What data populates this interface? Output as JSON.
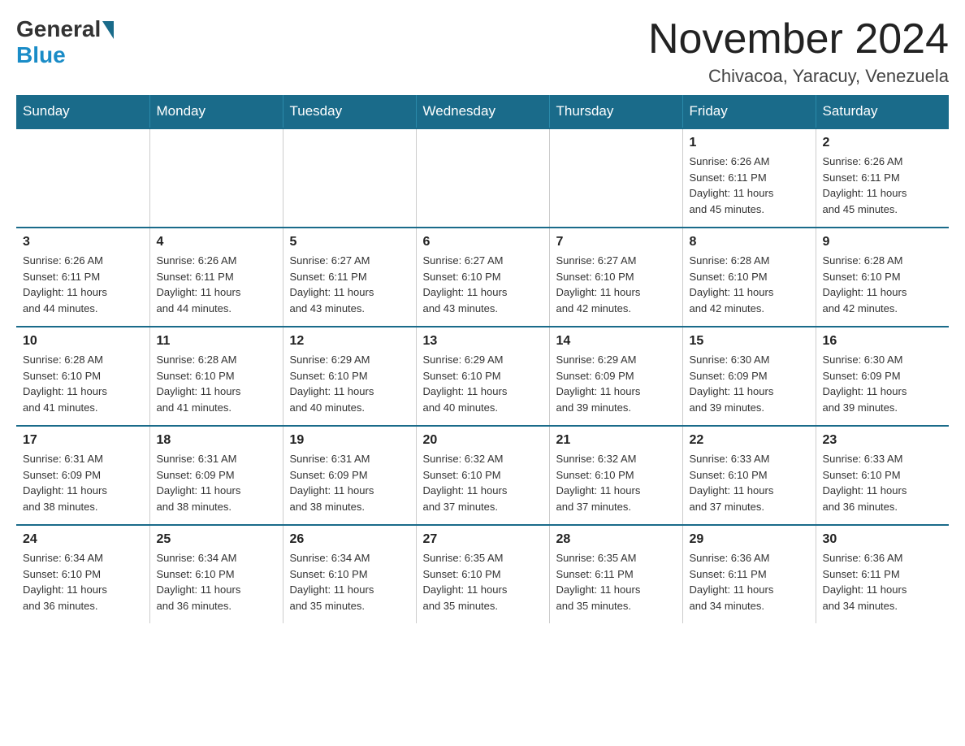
{
  "logo": {
    "text_general": "General",
    "text_blue": "Blue"
  },
  "title": "November 2024",
  "location": "Chivacoa, Yaracuy, Venezuela",
  "days_of_week": [
    "Sunday",
    "Monday",
    "Tuesday",
    "Wednesday",
    "Thursday",
    "Friday",
    "Saturday"
  ],
  "weeks": [
    [
      {
        "day": "",
        "info": ""
      },
      {
        "day": "",
        "info": ""
      },
      {
        "day": "",
        "info": ""
      },
      {
        "day": "",
        "info": ""
      },
      {
        "day": "",
        "info": ""
      },
      {
        "day": "1",
        "info": "Sunrise: 6:26 AM\nSunset: 6:11 PM\nDaylight: 11 hours\nand 45 minutes."
      },
      {
        "day": "2",
        "info": "Sunrise: 6:26 AM\nSunset: 6:11 PM\nDaylight: 11 hours\nand 45 minutes."
      }
    ],
    [
      {
        "day": "3",
        "info": "Sunrise: 6:26 AM\nSunset: 6:11 PM\nDaylight: 11 hours\nand 44 minutes."
      },
      {
        "day": "4",
        "info": "Sunrise: 6:26 AM\nSunset: 6:11 PM\nDaylight: 11 hours\nand 44 minutes."
      },
      {
        "day": "5",
        "info": "Sunrise: 6:27 AM\nSunset: 6:11 PM\nDaylight: 11 hours\nand 43 minutes."
      },
      {
        "day": "6",
        "info": "Sunrise: 6:27 AM\nSunset: 6:10 PM\nDaylight: 11 hours\nand 43 minutes."
      },
      {
        "day": "7",
        "info": "Sunrise: 6:27 AM\nSunset: 6:10 PM\nDaylight: 11 hours\nand 42 minutes."
      },
      {
        "day": "8",
        "info": "Sunrise: 6:28 AM\nSunset: 6:10 PM\nDaylight: 11 hours\nand 42 minutes."
      },
      {
        "day": "9",
        "info": "Sunrise: 6:28 AM\nSunset: 6:10 PM\nDaylight: 11 hours\nand 42 minutes."
      }
    ],
    [
      {
        "day": "10",
        "info": "Sunrise: 6:28 AM\nSunset: 6:10 PM\nDaylight: 11 hours\nand 41 minutes."
      },
      {
        "day": "11",
        "info": "Sunrise: 6:28 AM\nSunset: 6:10 PM\nDaylight: 11 hours\nand 41 minutes."
      },
      {
        "day": "12",
        "info": "Sunrise: 6:29 AM\nSunset: 6:10 PM\nDaylight: 11 hours\nand 40 minutes."
      },
      {
        "day": "13",
        "info": "Sunrise: 6:29 AM\nSunset: 6:10 PM\nDaylight: 11 hours\nand 40 minutes."
      },
      {
        "day": "14",
        "info": "Sunrise: 6:29 AM\nSunset: 6:09 PM\nDaylight: 11 hours\nand 39 minutes."
      },
      {
        "day": "15",
        "info": "Sunrise: 6:30 AM\nSunset: 6:09 PM\nDaylight: 11 hours\nand 39 minutes."
      },
      {
        "day": "16",
        "info": "Sunrise: 6:30 AM\nSunset: 6:09 PM\nDaylight: 11 hours\nand 39 minutes."
      }
    ],
    [
      {
        "day": "17",
        "info": "Sunrise: 6:31 AM\nSunset: 6:09 PM\nDaylight: 11 hours\nand 38 minutes."
      },
      {
        "day": "18",
        "info": "Sunrise: 6:31 AM\nSunset: 6:09 PM\nDaylight: 11 hours\nand 38 minutes."
      },
      {
        "day": "19",
        "info": "Sunrise: 6:31 AM\nSunset: 6:09 PM\nDaylight: 11 hours\nand 38 minutes."
      },
      {
        "day": "20",
        "info": "Sunrise: 6:32 AM\nSunset: 6:10 PM\nDaylight: 11 hours\nand 37 minutes."
      },
      {
        "day": "21",
        "info": "Sunrise: 6:32 AM\nSunset: 6:10 PM\nDaylight: 11 hours\nand 37 minutes."
      },
      {
        "day": "22",
        "info": "Sunrise: 6:33 AM\nSunset: 6:10 PM\nDaylight: 11 hours\nand 37 minutes."
      },
      {
        "day": "23",
        "info": "Sunrise: 6:33 AM\nSunset: 6:10 PM\nDaylight: 11 hours\nand 36 minutes."
      }
    ],
    [
      {
        "day": "24",
        "info": "Sunrise: 6:34 AM\nSunset: 6:10 PM\nDaylight: 11 hours\nand 36 minutes."
      },
      {
        "day": "25",
        "info": "Sunrise: 6:34 AM\nSunset: 6:10 PM\nDaylight: 11 hours\nand 36 minutes."
      },
      {
        "day": "26",
        "info": "Sunrise: 6:34 AM\nSunset: 6:10 PM\nDaylight: 11 hours\nand 35 minutes."
      },
      {
        "day": "27",
        "info": "Sunrise: 6:35 AM\nSunset: 6:10 PM\nDaylight: 11 hours\nand 35 minutes."
      },
      {
        "day": "28",
        "info": "Sunrise: 6:35 AM\nSunset: 6:11 PM\nDaylight: 11 hours\nand 35 minutes."
      },
      {
        "day": "29",
        "info": "Sunrise: 6:36 AM\nSunset: 6:11 PM\nDaylight: 11 hours\nand 34 minutes."
      },
      {
        "day": "30",
        "info": "Sunrise: 6:36 AM\nSunset: 6:11 PM\nDaylight: 11 hours\nand 34 minutes."
      }
    ]
  ]
}
